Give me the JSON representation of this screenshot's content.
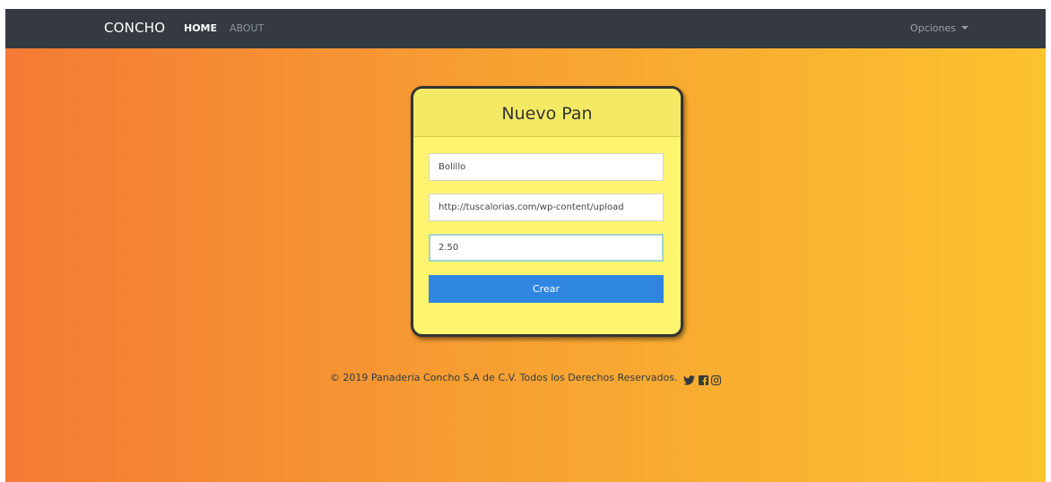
{
  "navbar": {
    "brand": "CONCHO",
    "links": [
      {
        "label": "HOME"
      },
      {
        "label": "ABOUT"
      }
    ],
    "options_label": "Opciones"
  },
  "form": {
    "title": "Nuevo Pan",
    "name_value": "Bolillo",
    "image_url_value": "http://tuscalorias.com/wp-content/upload",
    "price_value": "2.50",
    "submit_label": "Crear"
  },
  "footer": {
    "text": "© 2019 Panaderia Concho S.A de C.V. Todos los Derechos Reservados.",
    "icons": [
      "twitter-icon",
      "facebook-icon",
      "instagram-icon"
    ]
  },
  "colors": {
    "navbar_bg": "#343a40",
    "gradient_start": "#f47a35",
    "gradient_end": "#fcc22f",
    "card_bg": "#fff46e",
    "button_bg": "#2f86e0"
  }
}
